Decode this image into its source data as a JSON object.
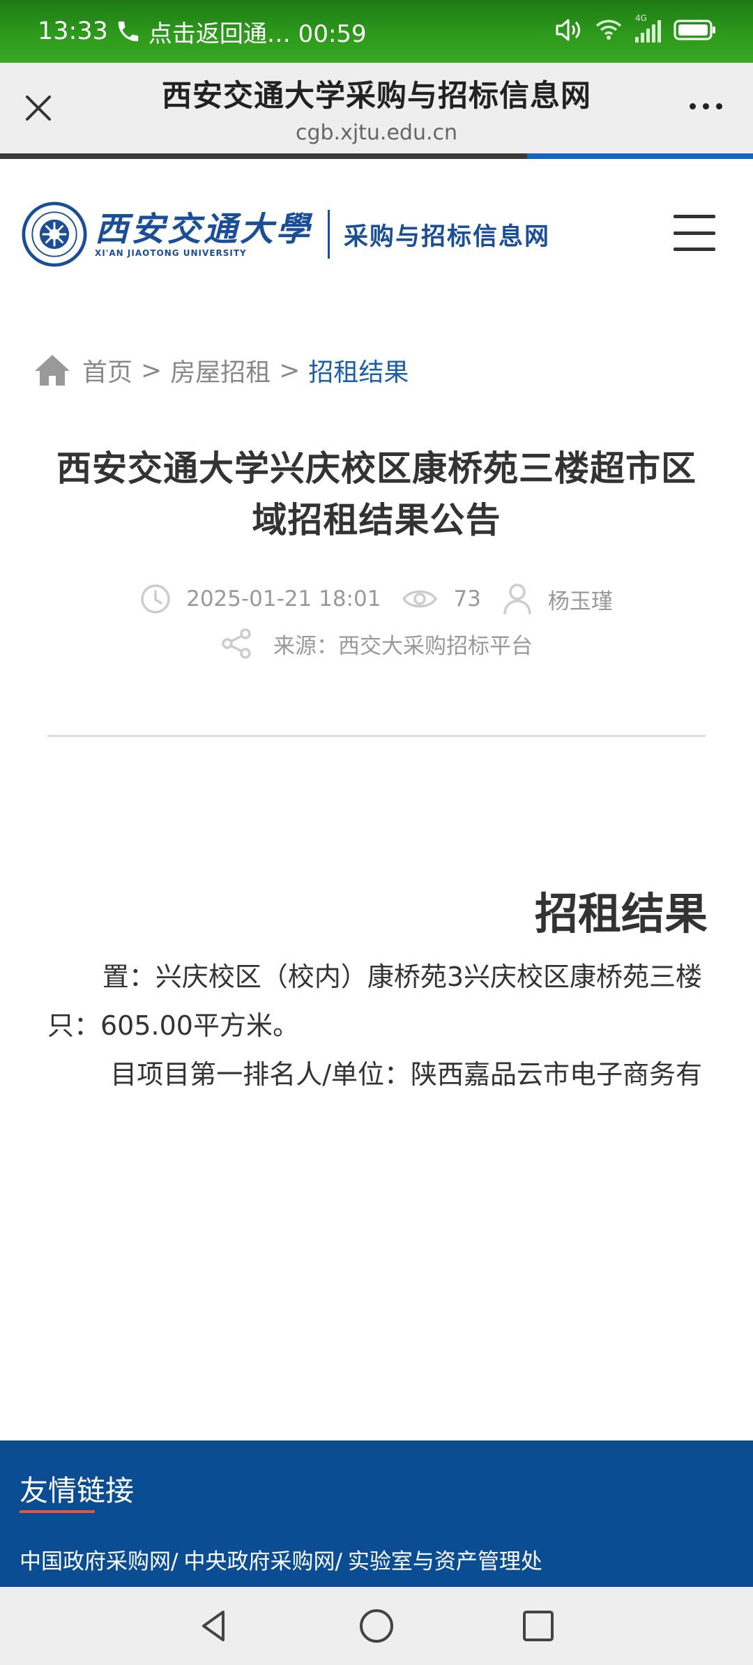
{
  "status_bar": {
    "time": "13:33",
    "call_text": "点击返回通… 00:59",
    "network_label": "4G"
  },
  "browser": {
    "title": "西安交通大学采购与招标信息网",
    "url": "cgb.xjtu.edu.cn",
    "load_progress": 0.7
  },
  "site": {
    "university_cn": "西安交通大學",
    "university_en": "XI'AN JIAOTONG UNIVERSITY",
    "site_name": "采购与招标信息网"
  },
  "breadcrumb": {
    "home": "首页",
    "separator": ">",
    "section": "房屋招租",
    "current": "招租结果"
  },
  "article": {
    "title": "西安交通大学兴庆校区康桥苑三楼超市区域招租结果公告",
    "date": "2025-01-21 18:01",
    "views": "73",
    "author": "杨玉瑾",
    "source": "来源：西交大采购招标平台"
  },
  "content": {
    "heading": "招租结果",
    "line1": "置：兴庆校区（校内）康桥苑3兴庆校区康桥苑三楼",
    "line2": "只：605.00平方米。",
    "line3": "目项目第一排名人/单位：陕西嘉品云市电子商务有"
  },
  "footer": {
    "title": "友情链接",
    "links": [
      "中国政府采购网/",
      "中央政府采购网/",
      "实验室与资产管理处"
    ]
  },
  "colors": {
    "status_bar": "#2d9a1c",
    "brand_blue": "#1a4e96",
    "link_blue": "#1a5fa8",
    "footer_bg": "#0a4d92",
    "footer_accent": "#e05a3a"
  }
}
